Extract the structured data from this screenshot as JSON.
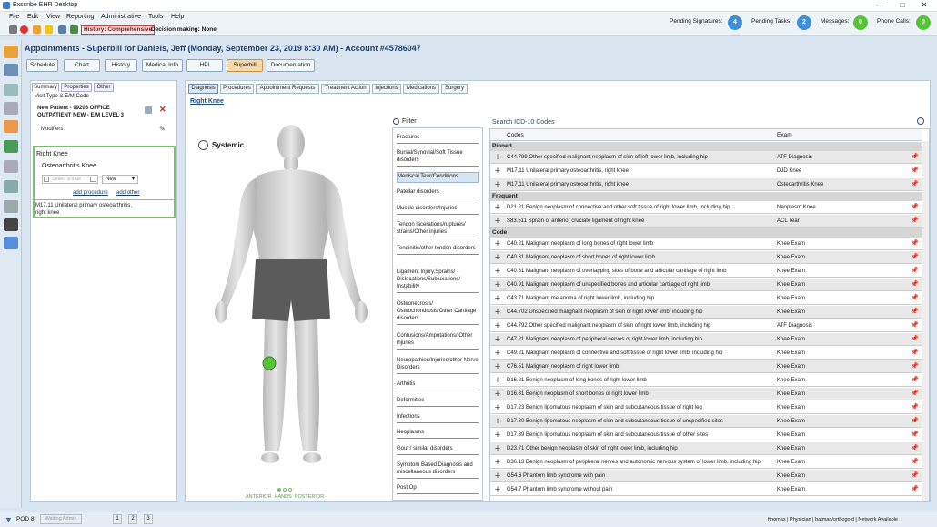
{
  "window": {
    "title": "Exscribe EHR Desktop"
  },
  "menu": [
    "File",
    "Edit",
    "View",
    "Reporting",
    "Administrative",
    "Tools",
    "Help"
  ],
  "toolbar": {
    "history": "History: Comprehensive",
    "decision": "Decision making: None"
  },
  "status": {
    "pending_signatures_label": "Pending Signatures:",
    "pending_signatures": "4",
    "pending_tasks_label": "Pending Tasks:",
    "pending_tasks": "2",
    "messages_label": "Messages:",
    "messages": "0",
    "phone_calls_label": "Phone Calls:",
    "phone_calls": "0",
    "colors": {
      "blue": "#3f8fd8",
      "green": "#58c33a"
    }
  },
  "app_title": "Appointments - Superbill for Daniels, Jeff (Monday, September 23, 2019 8:30 AM) - Account #45786047",
  "tabs": [
    "Schedule",
    "Chart",
    "History",
    "Medical Info",
    "HPI",
    "Superbill",
    "Documentation"
  ],
  "left_panel": {
    "tabs": [
      "Summary",
      "Properties",
      "Other"
    ],
    "visit_label": "Visit Type & E/M Code",
    "visit_line1": "New Patient - 99203 OFFICE",
    "visit_line2": "OUTPATIENT NEW - E/M LEVEL 3",
    "modifiers_label": "Modifiers:",
    "dx_title": "Right Knee",
    "dx_name": "Osteoarthritis Knee",
    "date_placeholder": "Select a date",
    "status_value": "New",
    "add_procedure": "add procedure",
    "add_other": "add other",
    "code_line1": "M17.11 Unilateral primary osteoarthritis,",
    "code_line2": "right knee"
  },
  "sub_tabs": [
    "Diagnosis",
    "Procedures",
    "Appointment Requests",
    "Treatment Action",
    "Injections",
    "Medications",
    "Surgery"
  ],
  "region_link": "Right Knee",
  "systemic_label": "Systemic",
  "body_views": "ANTERIOR  HANDS  POSTERIOR",
  "filter_label": "Filter",
  "categories": [
    "Fractures",
    "Bursal/Synovial/Soft Tissue disorders",
    "Meniscal Tear/Conditions",
    "Patellar disorders",
    "Muscle disorders/Injuries",
    "Tendon lacerations/ruptures/ strains/Other injuries",
    "Tendinitis/other tendon disorders",
    "Ligament Injury,Sprains/ Dislocations/Subluxations/ Instability",
    "Osteonecrosis/ Osteochondrosis/Other Cartilage disorders",
    "Contusions/Amputations/ Other injuries",
    "Neuropathies/Injuries/other Nerve Disorders",
    "Arthritis",
    "Deformities",
    "Infections",
    "Neoplasms",
    "Gout / similar disorders",
    "Symptom Based Diagnosis and miscellaneous disorders",
    "Post Op"
  ],
  "search_label": "Search ICD-10 Codes",
  "grid": {
    "col_codes": "Codes",
    "col_exam": "Exam",
    "sections": [
      {
        "title": "Pinned",
        "rows": [
          {
            "desc": "C44.799 Other specified malignant neoplasm of skin of left lower limb, including hip",
            "exam": "ATF Diagnosis"
          },
          {
            "desc": "M17.11 Unilateral primary osteoarthritis, right knee",
            "exam": "DJD Knee"
          },
          {
            "desc": "M17.11 Unilateral primary osteoarthritis, right knee",
            "exam": "Osteoarthritis Knee"
          }
        ]
      },
      {
        "title": "Frequent",
        "rows": [
          {
            "desc": "D21.21 Benign neoplasm of connective and other soft tissue of right lower limb, including hip",
            "exam": "Neoplasm Knee"
          },
          {
            "desc": "S83.511 Sprain of anterior cruciate ligament of right knee",
            "exam": "ACL Tear"
          }
        ]
      },
      {
        "title": "Code",
        "rows": [
          {
            "desc": "C40.21 Malignant neoplasm of long bones of right lower limb",
            "exam": "Knee Exam"
          },
          {
            "desc": "C40.31 Malignant neoplasm of short bones of right lower limb",
            "exam": "Knee Exam"
          },
          {
            "desc": "C40.81 Malignant neoplasm of overlapping sites of bone and articular cartilage of right limb",
            "exam": "Knee Exam"
          },
          {
            "desc": "C40.91 Malignant neoplasm of unspecified bones and articular cartilage of right limb",
            "exam": "Knee Exam"
          },
          {
            "desc": "C43.71 Malignant melanoma of right lower limb, including hip",
            "exam": "Knee Exam"
          },
          {
            "desc": "C44.702 Unspecified malignant neoplasm of skin of right lower limb, including hip",
            "exam": "Knee Exam"
          },
          {
            "desc": "C44.792 Other specified malignant neoplasm of skin of right lower limb, including hip",
            "exam": "ATF Diagnosis"
          },
          {
            "desc": "C47.21 Malignant neoplasm of peripheral nerves of right lower limb, including hip",
            "exam": "Knee Exam"
          },
          {
            "desc": "C49.21 Malignant neoplasm of connective and soft tissue of right lower limb, including hip",
            "exam": "Knee Exam"
          },
          {
            "desc": "C76.51 Malignant neoplasm of right lower limb",
            "exam": "Knee Exam"
          },
          {
            "desc": "D16.21 Benign neoplasm of long bones of right lower limb",
            "exam": "Knee Exam"
          },
          {
            "desc": "D16.31 Benign neoplasm of short bones of right lower limb",
            "exam": "Knee Exam"
          },
          {
            "desc": "D17.23 Benign lipomatous neoplasm of skin and subcutaneous tissue of right leg",
            "exam": "Knee Exam"
          },
          {
            "desc": "D17.30 Benign lipomatous neoplasm of skin and subcutaneous tissue of unspecified sites",
            "exam": "Knee Exam"
          },
          {
            "desc": "D17.39 Benign lipomatous neoplasm of skin and subcutaneous tissue of other sites",
            "exam": "Knee Exam"
          },
          {
            "desc": "D23.71 Other benign neoplasm of skin of right lower limb, including hip",
            "exam": "Knee Exam"
          },
          {
            "desc": "D36.13 Benign neoplasm of peripheral nerves and autonomic nervous system of lower limb, including hip",
            "exam": "Knee Exam"
          },
          {
            "desc": "G54.6 Phantom limb syndrome with pain",
            "exam": "Knee Exam"
          },
          {
            "desc": "G54.7 Phantom limb syndrome without pain",
            "exam": "Knee Exam"
          }
        ]
      }
    ]
  },
  "statusbar": {
    "pod": "POD 8",
    "waiting": "Waiting Admin",
    "pages": [
      "1",
      "2",
      "3"
    ],
    "right": "fthomas | Physician | batman/orthogold | Network Available"
  }
}
